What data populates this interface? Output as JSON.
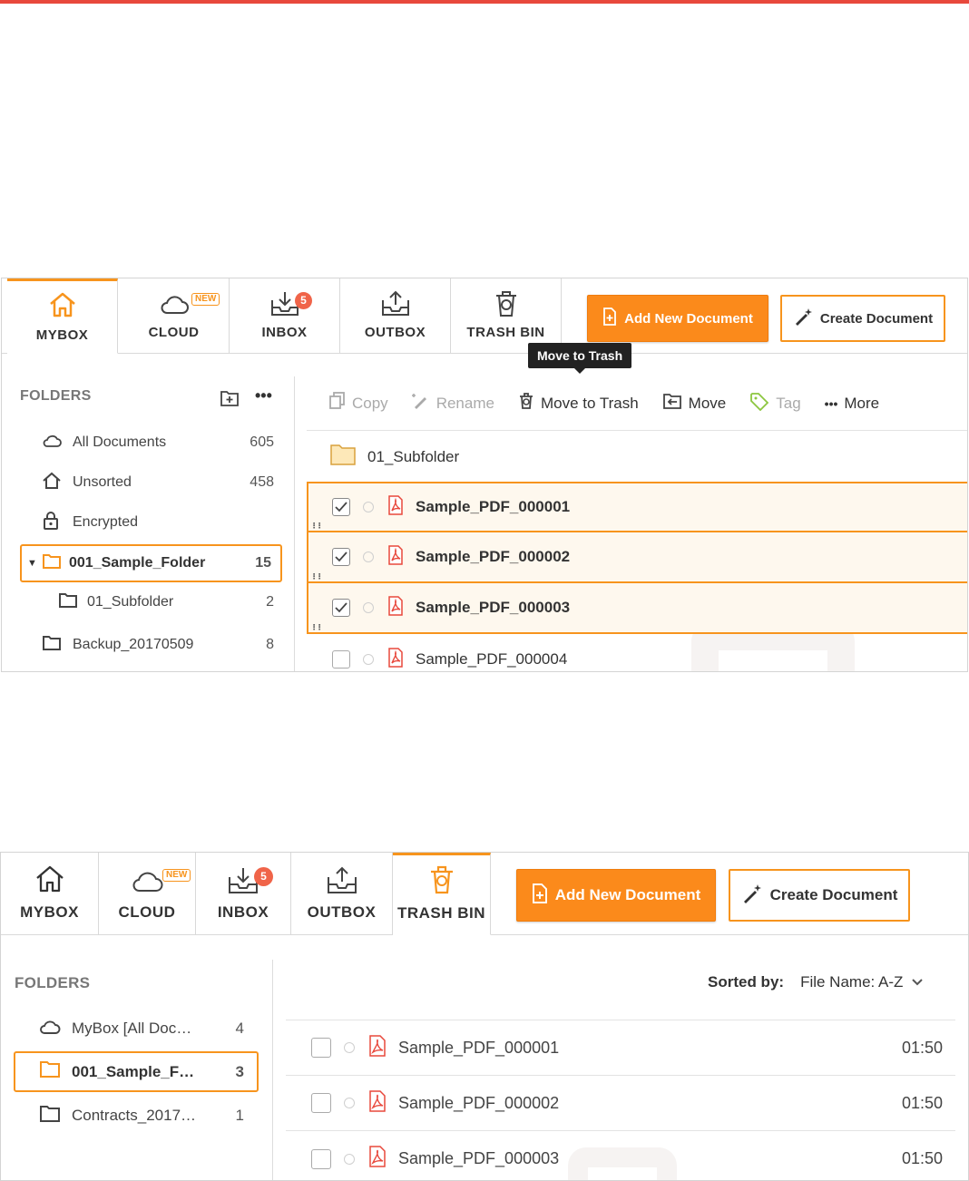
{
  "colors": {
    "accent": "#f7941d",
    "top_bar": "#e8483c",
    "badge": "#f06449"
  },
  "shot1": {
    "tabs": [
      {
        "label": "MYBOX",
        "icon": "home-icon",
        "active": true
      },
      {
        "label": "CLOUD",
        "icon": "cloud-icon",
        "badge": "NEW"
      },
      {
        "label": "INBOX",
        "icon": "inbox-icon",
        "badge": "5"
      },
      {
        "label": "OUTBOX",
        "icon": "outbox-icon"
      },
      {
        "label": "TRASH BIN",
        "icon": "trash-icon"
      }
    ],
    "add_button": "Add New Document",
    "create_button": "Create Document",
    "tooltip": "Move to Trash",
    "folders_title": "FOLDERS",
    "folders": [
      {
        "name": "All Documents",
        "count": "605",
        "icon": "cloud-icon"
      },
      {
        "name": "Unsorted",
        "count": "458",
        "icon": "home-icon"
      },
      {
        "name": "Encrypted",
        "count": "",
        "icon": "lock-icon"
      },
      {
        "name": "001_Sample_Folder",
        "count": "15",
        "icon": "folder-icon",
        "selected": true,
        "expanded": true
      },
      {
        "name": "01_Subfolder",
        "count": "2",
        "icon": "folder-icon",
        "indent": true
      },
      {
        "name": "Backup_20170509",
        "count": "8",
        "icon": "folder-icon"
      }
    ],
    "actions": [
      {
        "label": "Copy",
        "icon": "copy-icon",
        "enabled": false
      },
      {
        "label": "Rename",
        "icon": "pencil-icon",
        "enabled": false
      },
      {
        "label": "Move to Trash",
        "icon": "trash-icon",
        "enabled": true
      },
      {
        "label": "Move",
        "icon": "move-icon",
        "enabled": true
      },
      {
        "label": "Tag",
        "icon": "tag-icon",
        "enabled": false
      },
      {
        "label": "More",
        "icon": "more-icon",
        "enabled": true
      }
    ],
    "subfolder_row": "01_Subfolder",
    "files": [
      {
        "name": "Sample_PDF_000001",
        "checked": true
      },
      {
        "name": "Sample_PDF_000002",
        "checked": true
      },
      {
        "name": "Sample_PDF_000003",
        "checked": true
      },
      {
        "name": "Sample_PDF_000004",
        "checked": false
      }
    ]
  },
  "shot2": {
    "tabs": [
      {
        "label": "MYBOX",
        "icon": "home-icon"
      },
      {
        "label": "CLOUD",
        "icon": "cloud-icon",
        "badge": "NEW"
      },
      {
        "label": "INBOX",
        "icon": "inbox-icon",
        "badge": "5"
      },
      {
        "label": "OUTBOX",
        "icon": "outbox-icon"
      },
      {
        "label": "TRASH BIN",
        "icon": "trash-icon",
        "active": true
      }
    ],
    "add_button": "Add New Document",
    "create_button": "Create Document",
    "folders_title": "FOLDERS",
    "folders": [
      {
        "name": "MyBox [All Doc…",
        "count": "4",
        "icon": "cloud-icon"
      },
      {
        "name": "001_Sample_F…",
        "count": "3",
        "icon": "folder-icon",
        "selected": true
      },
      {
        "name": "Contracts_2017…",
        "count": "1",
        "icon": "folder-icon"
      }
    ],
    "sorted_label": "Sorted by:",
    "sorted_value": "File Name: A-Z",
    "files": [
      {
        "name": "Sample_PDF_000001",
        "time": "01:50"
      },
      {
        "name": "Sample_PDF_000002",
        "time": "01:50"
      },
      {
        "name": "Sample_PDF_000003",
        "time": "01:50"
      }
    ]
  }
}
